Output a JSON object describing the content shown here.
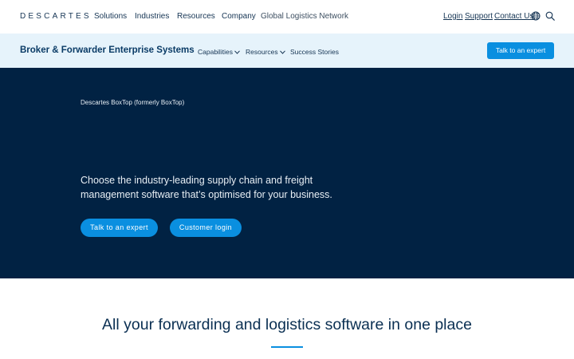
{
  "header": {
    "logo": "DESCARTES",
    "nav": [
      "Solutions",
      "Industries",
      "Resources",
      "Company",
      "Global Logistics Network"
    ],
    "utility": [
      "Login",
      "Support",
      "Contact Us"
    ]
  },
  "subnav": {
    "title": "Broker & Forwarder Enterprise Systems",
    "links": [
      "Capabilities",
      "Resources",
      "Success Stories"
    ],
    "cta": "Talk to an expert"
  },
  "hero": {
    "eyebrow": "Descartes BoxTop (formerly BoxTop)",
    "text": "Choose the industry-leading supply chain and freight management software that’s optimised for your business.",
    "primary_cta": "Talk to an expert",
    "secondary_cta": "Customer login"
  },
  "section": {
    "title": "All your forwarding and logistics software in one place"
  },
  "colors": {
    "accent": "#0a8fe0",
    "hero_bg": "#012243",
    "subnav_bg": "#e6f3fb"
  },
  "icons": [
    "globe-icon",
    "search-icon",
    "chevron-down-icon"
  ]
}
